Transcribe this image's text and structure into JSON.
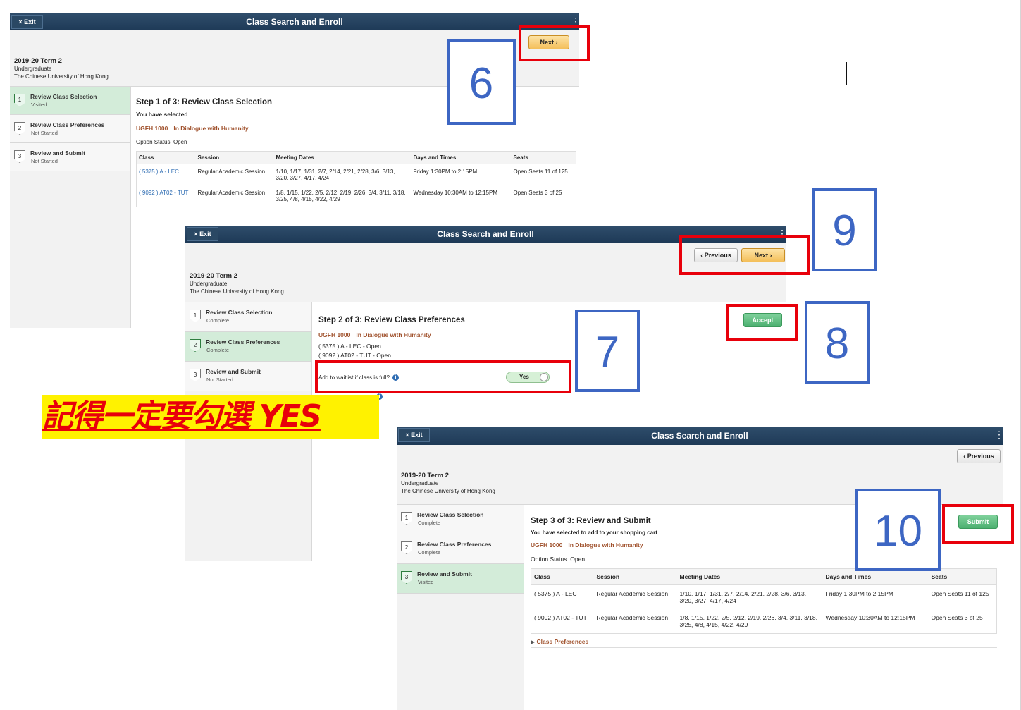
{
  "app": {
    "exit_label": "× Exit",
    "title": "Class Search and Enroll",
    "menu_icon": "⋮"
  },
  "term": {
    "name": "2019-20 Term 2",
    "career": "Undergraduate",
    "institution": "The Chinese University of Hong Kong"
  },
  "buttons": {
    "next": "Next ›",
    "previous": "‹ Previous",
    "accept": "Accept",
    "submit": "Submit"
  },
  "course": {
    "code": "UGFH 1000",
    "name": "In Dialogue with Humanity",
    "option_status_label": "Option Status",
    "option_status_value": "Open"
  },
  "table": {
    "headers": [
      "Class",
      "Session",
      "Meeting Dates",
      "Days and Times",
      "Seats"
    ],
    "rows": [
      {
        "class": "( 5375 ) A - LEC",
        "session": "Regular Academic Session",
        "dates": "1/10, 1/17, 1/31, 2/7, 2/14, 2/21, 2/28, 3/6, 3/13, 3/20, 3/27, 4/17, 4/24",
        "times": "Friday   1:30PM to 2:15PM",
        "seats": "Open Seats 11 of 125"
      },
      {
        "class": "( 9092 ) AT02 - TUT",
        "session": "Regular Academic Session",
        "dates": "1/8, 1/15, 1/22, 2/5, 2/12, 2/19, 2/26, 3/4, 3/11, 3/18, 3/25, 4/8, 4/15, 4/22, 4/29",
        "times": "Wednesday   10:30AM to 12:15PM",
        "seats": "Open Seats 3 of 25"
      }
    ]
  },
  "panel1": {
    "steps": [
      {
        "num": "1",
        "label": "Review Class Selection",
        "status": "Visited"
      },
      {
        "num": "2",
        "label": "Review Class Preferences",
        "status": "Not Started"
      },
      {
        "num": "3",
        "label": "Review and Submit",
        "status": "Not Started"
      }
    ],
    "heading": "Step 1 of 3: Review Class Selection",
    "selected_label": "You have selected"
  },
  "panel2": {
    "steps": [
      {
        "num": "1",
        "label": "Review Class Selection",
        "status": "Complete"
      },
      {
        "num": "2",
        "label": "Review Class Preferences",
        "status": "Complete"
      },
      {
        "num": "3",
        "label": "Review and Submit",
        "status": "Not Started"
      }
    ],
    "heading": "Step 2 of 3: Review Class Preferences",
    "class_line_1": "( 5375 ) A - LEC - Open",
    "class_line_2": "( 9092 ) AT02 - TUT - Open",
    "waitlist_label": "Add to waitlist if class is full?",
    "waitlist_value": "Yes"
  },
  "panel3": {
    "steps": [
      {
        "num": "1",
        "label": "Review Class Selection",
        "status": "Complete"
      },
      {
        "num": "2",
        "label": "Review Class Preferences",
        "status": "Complete"
      },
      {
        "num": "3",
        "label": "Review and Submit",
        "status": "Visited"
      }
    ],
    "heading": "Step 3 of 3: Review and Submit",
    "cart_label": "You have selected to add to your shopping cart",
    "prefs_link": "Class Preferences"
  },
  "annotations": {
    "n6": "6",
    "n7": "7",
    "n8": "8",
    "n9": "9",
    "n10": "10",
    "note": "記得一定要勾選 YES"
  },
  "colors": {
    "topbar": "#1e3a57",
    "annotation_red": "#e8000b",
    "annotation_blue": "#3d66c3",
    "highlight_yellow": "#fff200",
    "active_step": "#d3ecd9",
    "course_color": "#a0522d"
  }
}
